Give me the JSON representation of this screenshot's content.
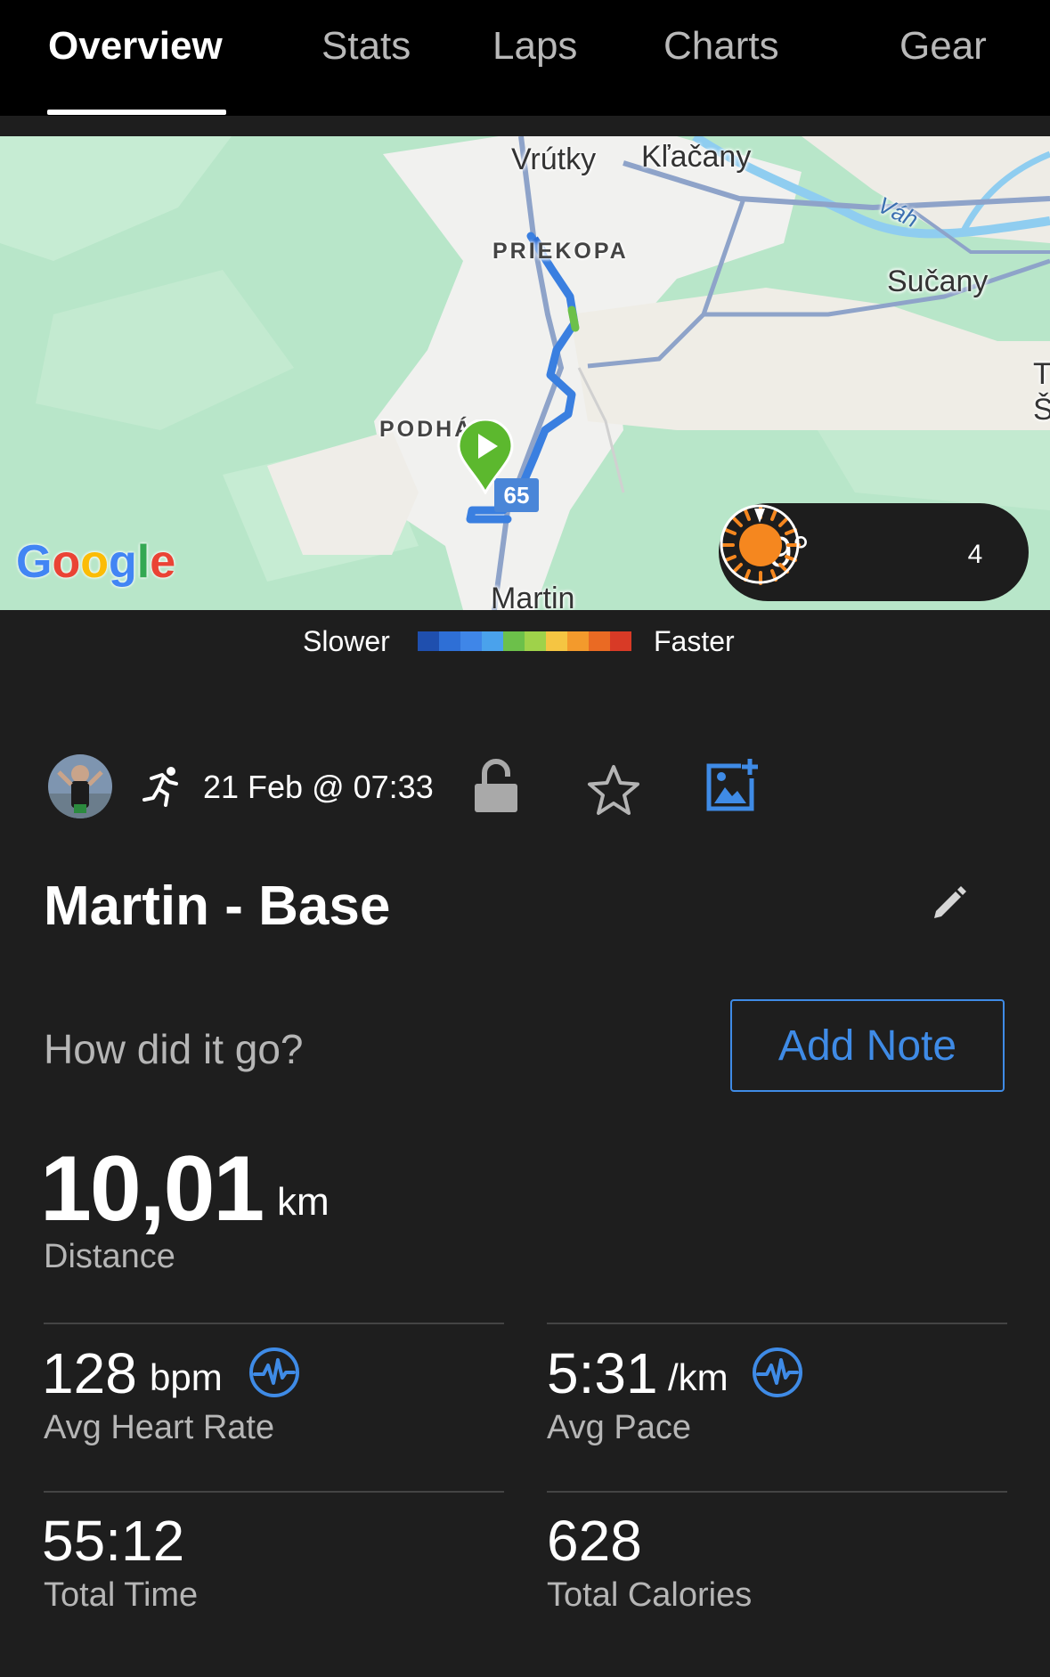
{
  "tabs": [
    {
      "label": "Overview",
      "active": true
    },
    {
      "label": "Stats"
    },
    {
      "label": "Laps"
    },
    {
      "label": "Charts"
    },
    {
      "label": "Gear"
    }
  ],
  "map": {
    "labels": {
      "vrutky": "Vrútky",
      "klacany": "Kľačany",
      "priekopa": "PRIEKOPA",
      "vah": "Váh",
      "sucany": "Sučany",
      "podha": "PODHÁ",
      "martin": "Martin",
      "edge_t": "T",
      "edge_s": "Š"
    },
    "road_number": "65",
    "attribution": "Google",
    "weather": {
      "temperature": "-9°",
      "condition_icon": "sun-icon",
      "wind_speed": "4"
    }
  },
  "legend": {
    "slower": "Slower",
    "faster": "Faster",
    "colors": [
      "#1f4fae",
      "#2e6fd6",
      "#3f86e8",
      "#4aa2ec",
      "#6cc04a",
      "#9fd24a",
      "#f5c542",
      "#f39a2c",
      "#ea6a23",
      "#d83a26"
    ]
  },
  "activity": {
    "type_icon": "running-icon",
    "date": "21 Feb @ 07:33",
    "title": "Martin - Base",
    "note_prompt": "How did it go?",
    "add_note_label": "Add Note"
  },
  "stats": {
    "distance": {
      "value": "10,01",
      "unit": "km",
      "label": "Distance"
    },
    "avg_heart_rate": {
      "value": "128",
      "unit": "bpm",
      "label": "Avg Heart Rate"
    },
    "avg_pace": {
      "value": "5:31",
      "unit": "/km",
      "label": "Avg Pace"
    },
    "total_time": {
      "value": "55:12",
      "label": "Total Time"
    },
    "total_calories": {
      "value": "628",
      "label": "Total Calories"
    }
  },
  "colors": {
    "accent_blue": "#3f8be6",
    "route_blue": "#3a7fe0",
    "start_marker_green": "#5cb82e",
    "background": "#1e1e1e"
  }
}
